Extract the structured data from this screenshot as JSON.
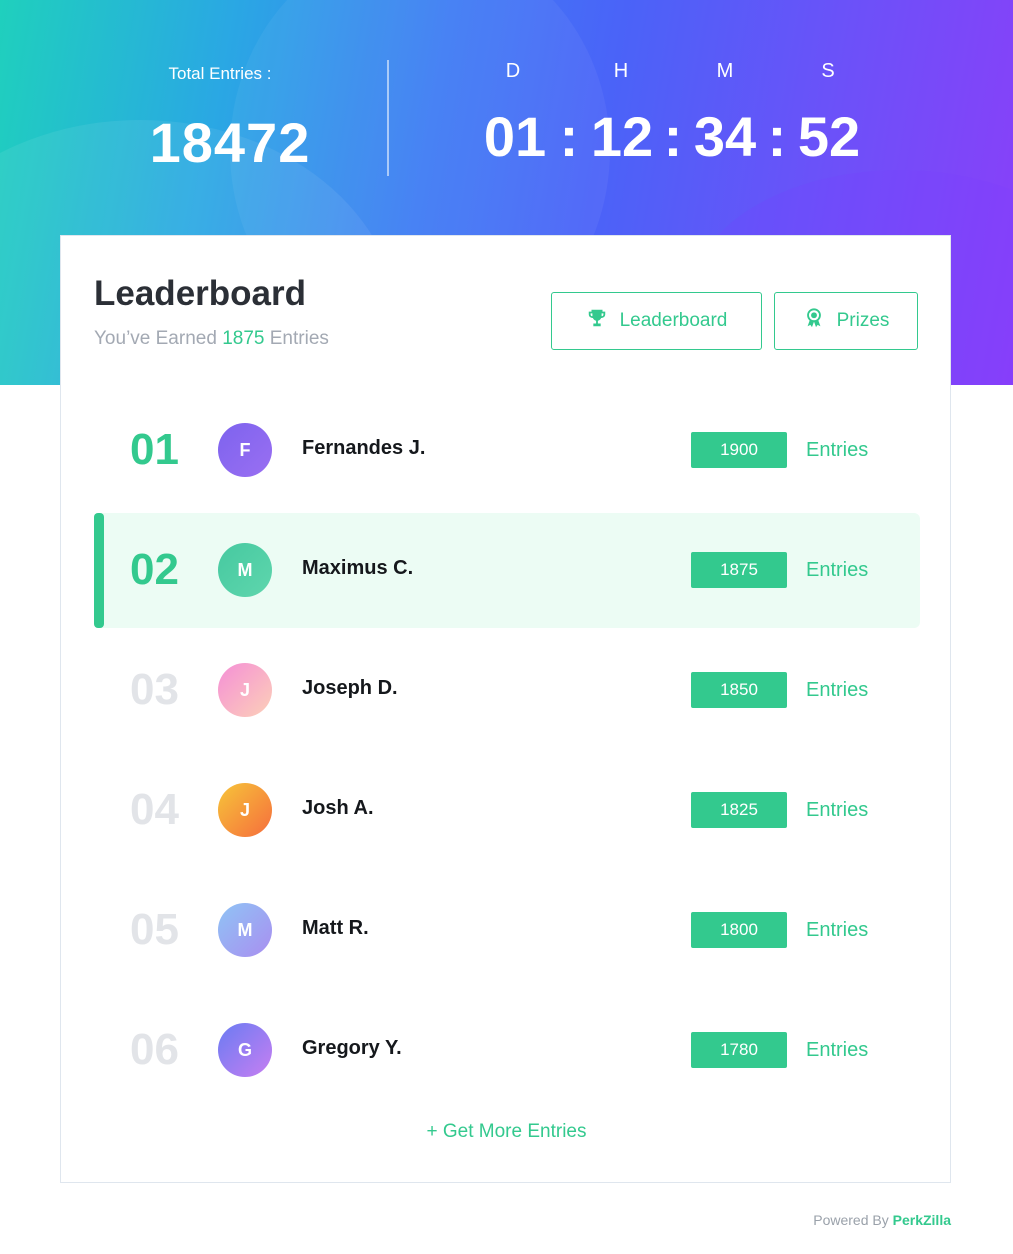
{
  "stats": {
    "total_label": "Total Entries :",
    "total_value": "18472"
  },
  "countdown": {
    "units": [
      "D",
      "H",
      "M",
      "S"
    ],
    "values": [
      "01",
      "12",
      "34",
      "52"
    ],
    "separator": ":"
  },
  "leaderboard": {
    "title": "Leaderboard",
    "subtitle_prefix": "You’ve Earned",
    "subtitle_value": "1875",
    "subtitle_suffix": "Entries",
    "tabs": [
      {
        "label": "Leaderboard",
        "icon": "trophy-icon"
      },
      {
        "label": "Prizes",
        "icon": "award-ribbon-icon"
      }
    ],
    "rows": [
      {
        "rank": "01",
        "initial": "F",
        "name": "Fernandes J.",
        "entries": "1900",
        "unit": "Entries"
      },
      {
        "rank": "02",
        "initial": "M",
        "name": "Maximus C.",
        "entries": "1875",
        "unit": "Entries"
      },
      {
        "rank": "03",
        "initial": "J",
        "name": "Joseph D.",
        "entries": "1850",
        "unit": "Entries"
      },
      {
        "rank": "04",
        "initial": "J",
        "name": "Josh A.",
        "entries": "1825",
        "unit": "Entries"
      },
      {
        "rank": "05",
        "initial": "M",
        "name": "Matt R.",
        "entries": "1800",
        "unit": "Entries"
      },
      {
        "rank": "06",
        "initial": "G",
        "name": "Gregory Y.",
        "entries": "1780",
        "unit": "Entries"
      }
    ],
    "more_link": "+ Get More Entries"
  },
  "footer": {
    "powered_prefix": "Powered By",
    "brand": "PerkZilla"
  },
  "colors": {
    "accent": "#33c98e",
    "highlight_row": "#ecfcf4",
    "avatar_gradients": [
      [
        "#7d63ee",
        "#9a6ff2"
      ],
      [
        "#46c9a0",
        "#5fd6ad"
      ],
      [
        "#f58fd6",
        "#fcd0b8"
      ],
      [
        "#f7c53a",
        "#f56d3c"
      ],
      [
        "#8fc4f5",
        "#a98ef0"
      ],
      [
        "#6a7cf3",
        "#c77ef1"
      ]
    ]
  }
}
